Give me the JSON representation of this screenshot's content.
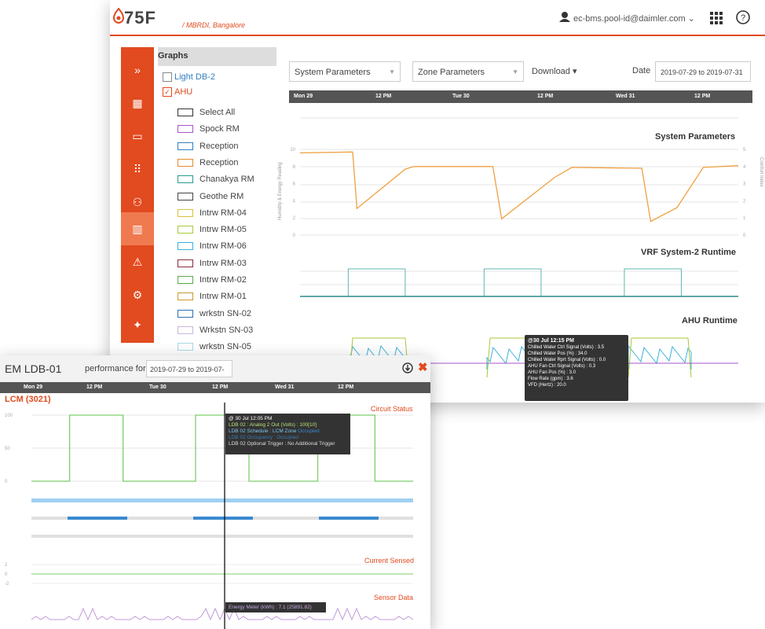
{
  "app": {
    "logo_text": "75F",
    "site": "/ MBRDI, Bangalore"
  },
  "header": {
    "user": "ec-bms.pool-id@daimler.com",
    "user_caret": "⌄"
  },
  "graphs_panel": {
    "title": "Graphs",
    "groups": [
      {
        "label": "Light DB-2",
        "checked": false
      },
      {
        "label": "AHU",
        "checked": true
      }
    ],
    "items": [
      {
        "label": "Select All",
        "color": "#333333"
      },
      {
        "label": "Spock RM",
        "color": "#a855c8"
      },
      {
        "label": "Reception",
        "color": "#2f7fc1"
      },
      {
        "label": "Reception",
        "color": "#e08a2a"
      },
      {
        "label": "Chanakya RM",
        "color": "#2a9a8a"
      },
      {
        "label": "Geothe RM",
        "color": "#444444"
      },
      {
        "label": "Intrw RM-04",
        "color": "#d8c23a"
      },
      {
        "label": "Intrw RM-05",
        "color": "#a8c83a"
      },
      {
        "label": "Intrw RM-06",
        "color": "#39b2d8"
      },
      {
        "label": "Intrw RM-03",
        "color": "#8a2a3a"
      },
      {
        "label": "Intrw RM-02",
        "color": "#5aa84a"
      },
      {
        "label": "Intrw RM-01",
        "color": "#c89a2a"
      },
      {
        "label": "wrkstn SN-02",
        "color": "#2f6fb1"
      },
      {
        "label": "Wrkstn SN-03",
        "color": "#c8b8d8"
      },
      {
        "label": "wrkstn SN-05",
        "color": "#a8d8e8"
      }
    ]
  },
  "controls": {
    "system_params": "System Parameters",
    "zone_params": "Zone Parameters",
    "download": "Download",
    "date_label": "Date",
    "date_value": "2019-07-29 to 2019-07-31"
  },
  "timeline": [
    "Mon 29",
    "12 PM",
    "Tue 30",
    "12 PM",
    "Wed 31",
    "12 PM"
  ],
  "charts": {
    "system_parameters": "System Parameters",
    "vrf_runtime": "VRF System-2 Runtime",
    "ahu_runtime": "AHU Runtime",
    "left_axis_label": "Humidity & Energy Reading",
    "right_axis_label": "Comfort Index"
  },
  "tooltip_main": {
    "title": "@30 Jul 12:15 PM",
    "lines": [
      "Chilled Water Ctrl Signal (Volts) : 3.5",
      "Chilled Water Pos (%) : 34.0",
      "Chilled Water Rprt Signal (Volts) : 0.0",
      "AHU Fan Ctrl Signal (Volts) : 0.3",
      "AHU Fan Pos (%) : 3.0",
      "Flow Rate (gpm) : 3.6",
      "VFD (Hertz) : 20.0"
    ]
  },
  "em_window": {
    "title": "EM LDB-01",
    "perf_label": "performance for",
    "date_value": "2019-07-29 to 2019-07-31",
    "section": "LCM (3021)",
    "circuit_status": "Circuit Status",
    "current_sensed": "Current Sensed",
    "sensor_data": "Sensor Data",
    "tooltip": {
      "title": "@ 30 Jul 12:05 PM",
      "lines": [
        "LDB 02 : Analog 2 Out (Volts) : 100[10]",
        "LDB 02 Schedule : LCM Zone",
        "LDB 02 Occupancy : Occupied",
        "LDB 02 Optional Trigger : No Additional Trigger"
      ],
      "occupied": "Occupied"
    },
    "sensor_tooltip": "Energy Meter (kWh) : 7.1 (25891.82)",
    "y_ticks": [
      "100",
      "50",
      "0"
    ],
    "y_ticks_current": [
      "2",
      "0",
      "-2"
    ]
  },
  "chart_data": [
    {
      "type": "line",
      "title": "System Parameters",
      "ylabel": "Humidity & Energy Reading",
      "ylim": [
        0,
        10
      ],
      "y2label": "Comfort Index",
      "y2lim": [
        0,
        5
      ],
      "x": [
        "Mon 29",
        "12 PM",
        "Tue 30",
        "12 PM",
        "Wed 31",
        "12 PM"
      ],
      "series": [
        {
          "color": "#f0a040",
          "values": [
            9.6,
            9.7,
            3.1,
            7.7,
            8.0,
            8.0,
            1.9,
            6.7,
            7.9,
            7.8,
            1.6,
            3.2,
            7.9,
            8.1
          ]
        }
      ]
    },
    {
      "type": "line",
      "title": "VRF System-2 Runtime",
      "ylim": [
        0,
        4
      ],
      "series": [
        {
          "color": "#5fb8b0",
          "values": [
            0,
            4,
            0,
            4,
            0,
            4,
            0
          ]
        }
      ]
    },
    {
      "type": "line",
      "title": "Circuit Status",
      "ylim": [
        0,
        100
      ],
      "series": [
        {
          "color": "#7ccf6a",
          "values": [
            0,
            100,
            0,
            100,
            0,
            100,
            0
          ]
        }
      ]
    }
  ],
  "colors": {
    "accent": "#e24a1f",
    "timebar": "#555555"
  }
}
